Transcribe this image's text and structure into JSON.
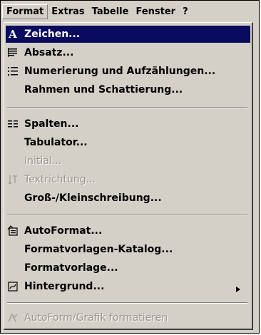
{
  "menubar": {
    "items": [
      "Format",
      "Extras",
      "Tabelle",
      "Fenster",
      "?"
    ]
  },
  "menu": {
    "items": [
      {
        "label": "Zeichen...",
        "icon": "character-a-icon",
        "state": "highlighted"
      },
      {
        "label": "Absatz...",
        "icon": "paragraph-icon"
      },
      {
        "label": "Numerierung und Aufzählungen...",
        "icon": "numbered-list-icon"
      },
      {
        "label": "Rahmen und Schattierung..."
      },
      {
        "label": "Spalten...",
        "icon": "columns-icon"
      },
      {
        "label": "Tabulator..."
      },
      {
        "label": "Initial...",
        "state": "disabled"
      },
      {
        "label": "Textrichtung...",
        "icon": "text-direction-icon",
        "state": "disabled"
      },
      {
        "label": "Groß-/Kleinschreibung..."
      },
      {
        "label": "AutoFormat...",
        "icon": "autoformat-icon"
      },
      {
        "label": "Formatvorlagen-Katalog..."
      },
      {
        "label": "Formatvorlage..."
      },
      {
        "label": "Hintergrund...",
        "icon": "background-icon",
        "submenu": true
      },
      {
        "label": "AutoForm/Grafik formatieren",
        "icon": "autoshape-format-icon",
        "state": "disabled"
      }
    ]
  },
  "colors": {
    "menu_bg": "#d4d0c8",
    "highlight": "#0a0a5e",
    "disabled_text": "#9a968e"
  }
}
